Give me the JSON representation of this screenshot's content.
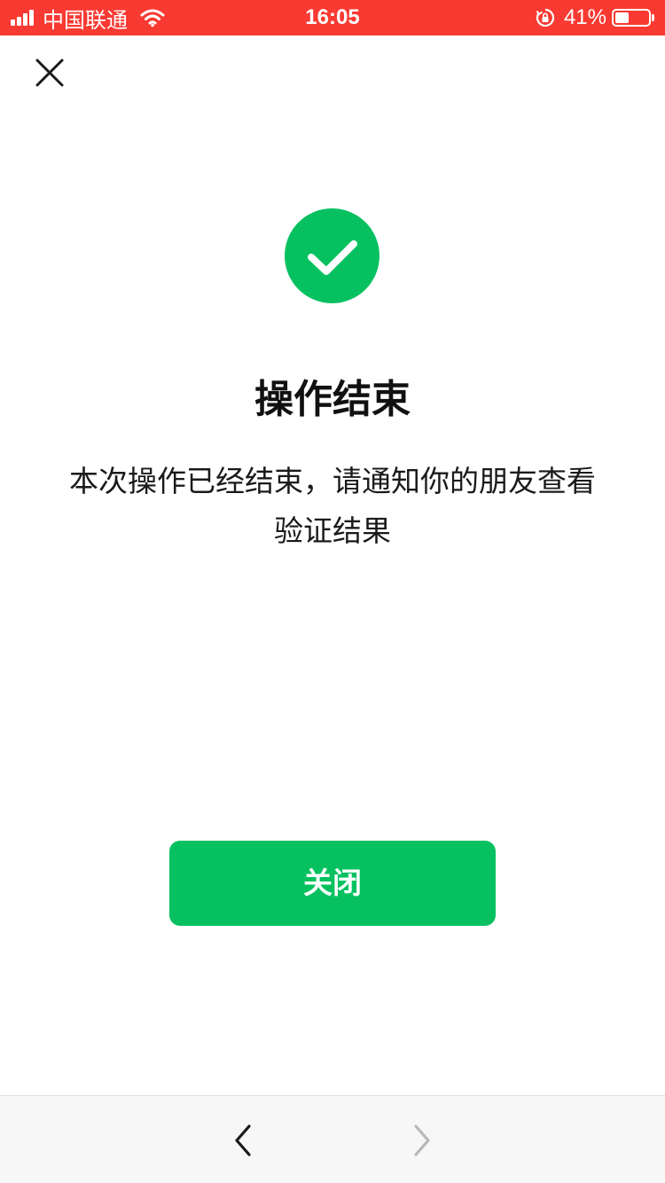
{
  "status_bar": {
    "carrier": "中国联通",
    "time": "16:05",
    "battery_percent": "41%",
    "battery_level": 0.41,
    "icons": [
      "signal-icon",
      "wifi-icon",
      "rotation-lock-icon",
      "battery-icon"
    ]
  },
  "header": {
    "close_icon": "close-icon"
  },
  "result": {
    "icon": "success-check-icon",
    "icon_color": "#07c160",
    "title": "操作结束",
    "description": "本次操作已经结束，请通知你的朋友查看验证结果"
  },
  "actions": {
    "close_label": "关闭",
    "button_color": "#07c160"
  },
  "bottom_bar": {
    "back_icon": "chevron-left-icon",
    "forward_icon": "chevron-right-icon"
  },
  "colors": {
    "status_bar_bg": "#f83a32"
  }
}
